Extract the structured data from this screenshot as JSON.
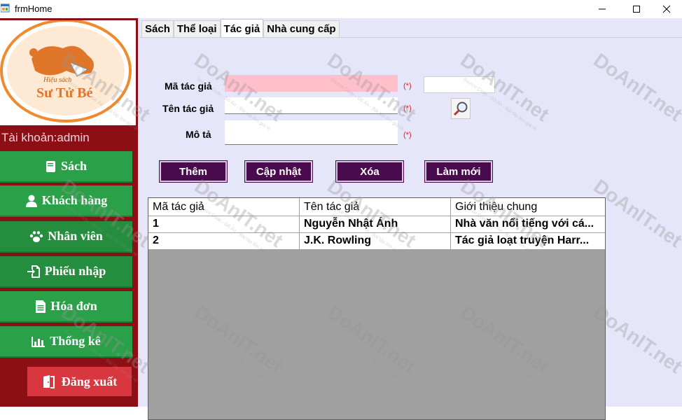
{
  "window": {
    "title": "frmHome"
  },
  "sidebar": {
    "logo": {
      "top_text": "Hiệu sách",
      "brand": "Sư Tử Bé"
    },
    "account_label": "Tài khoản:admin",
    "items": [
      {
        "label": "Sách",
        "icon": "book-icon"
      },
      {
        "label": "Khách hàng",
        "icon": "user-icon"
      },
      {
        "label": "Nhân viên",
        "icon": "paw-icon"
      },
      {
        "label": "Phiếu nhập",
        "icon": "import-icon"
      },
      {
        "label": "Hóa đơn",
        "icon": "document-icon"
      },
      {
        "label": "Thống kê",
        "icon": "bar-chart-icon"
      }
    ],
    "logout_label": "Đăng xuất"
  },
  "tabs": [
    "Sách",
    "Thể loại",
    "Tác giả",
    "Nhà cung cấp"
  ],
  "active_tab": "Tác giả",
  "form": {
    "author_id_label": "Mã tác giả",
    "author_name_label": "Tên tác giả",
    "description_label": "Mô tả",
    "required_mark": "(*)",
    "author_id_value": "",
    "author_name_value": "",
    "description_value": "",
    "search_value": ""
  },
  "actions": {
    "add": "Thêm",
    "update": "Cập nhật",
    "delete": "Xóa",
    "refresh": "Làm mới"
  },
  "grid": {
    "columns": [
      "Mã tác giả",
      "Tên tác giả",
      "Giới thiệu chung"
    ],
    "rows": [
      [
        "1",
        "Nguyễn Nhật Ánh",
        "Nhà văn nổi tiếng với cá..."
      ],
      [
        "2",
        "J.K. Rowling",
        "Tác giả loạt truyện Harr..."
      ]
    ]
  },
  "watermark": {
    "text": "DoAnIT.net",
    "subtext": "Source Code - Đồ Án - Bài tập lớn giá rẻ"
  },
  "colors": {
    "sidebar_bg": "#8b0f14",
    "nav_green": "#2aa148",
    "action_purple": "#4a0a4e",
    "main_bg": "#e6e6fa",
    "logout_red": "#d9373f",
    "pink_field": "#ffc0cb"
  }
}
